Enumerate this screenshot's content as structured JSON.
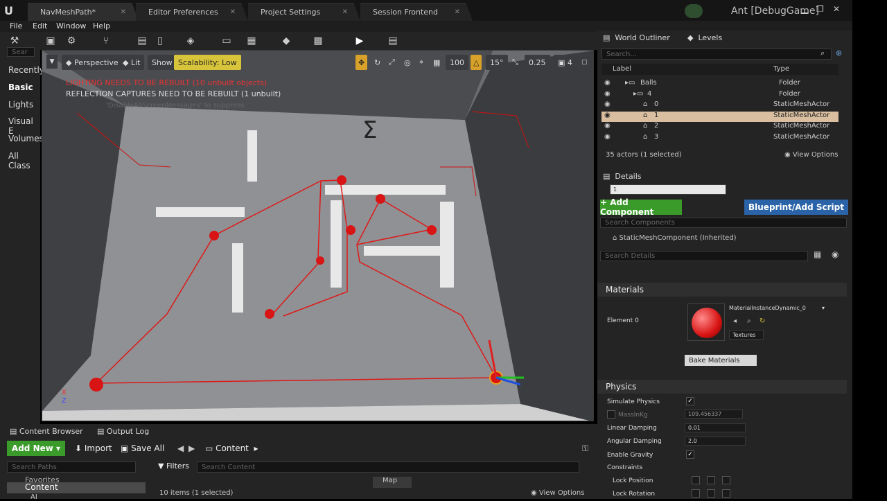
{
  "tabs": [
    {
      "label": "NavMeshPath*"
    },
    {
      "label": "Editor Preferences"
    },
    {
      "label": "Project Settings"
    },
    {
      "label": "Session Frontend"
    }
  ],
  "window_title": "Ant [DebugGame]",
  "menu": [
    "File",
    "Edit",
    "Window",
    "Help"
  ],
  "left_panel": {
    "search_placeholder": "Sear",
    "items": [
      "Recently",
      "Basic",
      "Lights",
      "Visual E",
      "Volumes",
      "All Class"
    ]
  },
  "viewport": {
    "perspective": "Perspective",
    "lit": "Lit",
    "show": "Show",
    "scalability": "Scalability: Low",
    "grid_size": "100",
    "rot_snap": "15°",
    "scale_snap": "0.25",
    "cam_speed": "4",
    "warning_lighting": "LIGHTING NEEDS TO BE REBUILT (10 unbuilt objects)",
    "warning_reflection": "REFLECTION CAPTURES NEED TO BE REBUILT (1 unbuilt)",
    "warning_hint": "'DisableAllScreenMessages' to suppress",
    "colors": {
      "path": "#e01818",
      "ball": "#d81414",
      "floor": "#8f9194",
      "wall": "#e8e8e8"
    }
  },
  "outliner": {
    "tab_world": "World Outliner",
    "tab_levels": "Levels",
    "search_placeholder": "Search...",
    "col_label": "Label",
    "col_type": "Type",
    "rows": [
      {
        "label": "Balls",
        "type": "Folder"
      },
      {
        "label": "4",
        "type": "Folder"
      },
      {
        "label": "0",
        "type": "StaticMeshActor"
      },
      {
        "label": "1",
        "type": "StaticMeshActor"
      },
      {
        "label": "2",
        "type": "StaticMeshActor"
      },
      {
        "label": "3",
        "type": "StaticMeshActor"
      }
    ],
    "footer": "35 actors (1 selected)",
    "view_options": "View Options"
  },
  "details": {
    "tab": "Details",
    "name_value": "1",
    "add_component": "+ Add Component",
    "blueprint": "Blueprint/Add Script",
    "search_components": "Search Components",
    "component": "StaticMeshComponent (Inherited)",
    "search_details": "Search Details",
    "materials_header": "Materials",
    "element0": "Element 0",
    "material_name": "MaterialInstanceDynamic_0",
    "textures": "Textures",
    "bake_materials": "Bake Materials",
    "physics_header": "Physics",
    "simulate_physics": "Simulate Physics",
    "mass_label": "MassInKg",
    "mass_value": "109.456337",
    "linear_damping_label": "Linear Damping",
    "linear_damping_value": "0.01",
    "angular_damping_label": "Angular Damping",
    "angular_damping_value": "2.0",
    "enable_gravity": "Enable Gravity",
    "constraints": "Constraints",
    "lock_position": "Lock Position",
    "lock_rotation": "Lock Rotation"
  },
  "content_browser": {
    "tab": "Content Browser",
    "output_tab": "Output Log",
    "add_new": "Add New",
    "import": "Import",
    "save_all": "Save All",
    "path": "Content",
    "search_paths": "Search Paths",
    "filters": "Filters",
    "search_content": "Search Content",
    "tree_favorites": "Favorites",
    "tree_content": "Content",
    "tree_ai": "AI",
    "items_count": "10 items (1 selected)",
    "view_options": "View Options",
    "map_label": "Map"
  }
}
